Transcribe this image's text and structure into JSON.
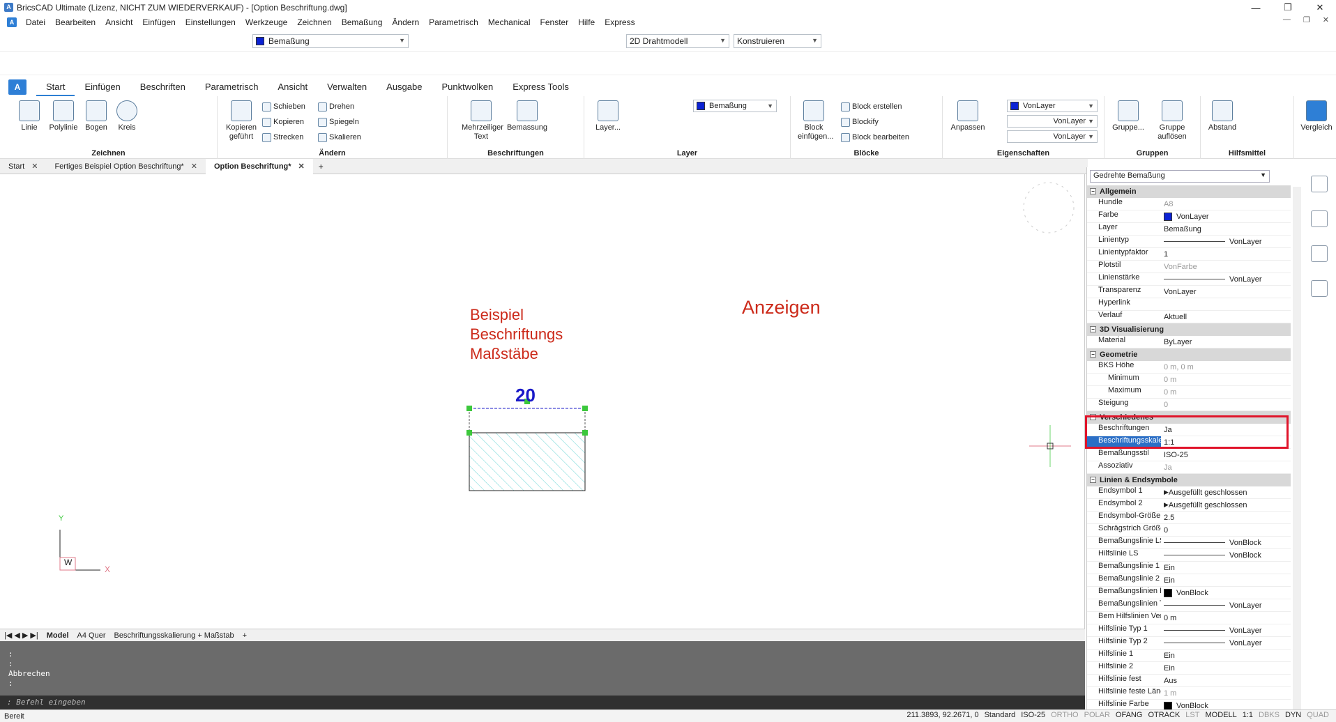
{
  "window": {
    "title": "BricsCAD Ultimate (Lizenz, NICHT ZUM WIEDERVERKAUF) - [Option Beschriftung.dwg]",
    "controls": [
      "—",
      "❐",
      "✕"
    ]
  },
  "menubar": {
    "items": [
      "Datei",
      "Bearbeiten",
      "Ansicht",
      "Einfügen",
      "Einstellungen",
      "Werkzeuge",
      "Zeichnen",
      "Bemaßung",
      "Ändern",
      "Parametrisch",
      "Mechanical",
      "Fenster",
      "Hilfe",
      "Express"
    ]
  },
  "toolbar": {
    "layer_combo": "Bemaßung",
    "workspace_combo": "2D Drahtmodell",
    "mode_combo": "Konstruieren"
  },
  "ribbon": {
    "tabs": [
      "Start",
      "Einfügen",
      "Beschriften",
      "Parametrisch",
      "Ansicht",
      "Verwalten",
      "Ausgabe",
      "Punktwolken",
      "Express Tools"
    ],
    "groups": {
      "zeichnen": "Zeichnen",
      "aendern": "Ändern",
      "beschriftungen": "Beschriftungen",
      "layer": "Layer",
      "bloecke": "Blöcke",
      "eigenschaften": "Eigenschaften",
      "gruppen": "Gruppen",
      "hilfsmittel": "Hilfsmittel"
    },
    "zeichnen": {
      "linie": "Linie",
      "polylinie": "Polylinie",
      "bogen": "Bogen",
      "kreis": "Kreis"
    },
    "aendern": {
      "kopieren_gefuehrt": "Kopieren geführt",
      "schieben": "Schieben",
      "kopieren": "Kopieren",
      "strecken": "Strecken",
      "drehen": "Drehen",
      "spiegeln": "Spiegeln",
      "skalieren": "Skalieren"
    },
    "beschriftungen": {
      "mtext": "Mehrzeiliger Text",
      "bemassung": "Bemassung"
    },
    "layer": {
      "layer_btn": "Layer...",
      "current": "Bemaßung"
    },
    "bloecke": {
      "einfuegen": "Block einfügen...",
      "erstellen": "Block erstellen",
      "blockify": "Blockify",
      "bearbeiten": "Block bearbeiten"
    },
    "eigenschaften": {
      "anpassen": "Anpassen",
      "color": "VonLayer",
      "linetype": "VonLayer",
      "lineweight": "VonLayer"
    },
    "gruppen": {
      "gruppe": "Gruppe...",
      "aufloesen": "Gruppe auflösen"
    },
    "hilfsmittel": {
      "abstand": "Abstand"
    },
    "vergleich": "Vergleich"
  },
  "doctabs": [
    {
      "label": "Start",
      "active": false
    },
    {
      "label": "Fertiges Beispiel Option Beschriftung*",
      "active": false
    },
    {
      "label": "Option Beschriftung*",
      "active": true
    }
  ],
  "drawing": {
    "text_block": [
      "Beispiel",
      "Beschriftungs",
      "Maßstäbe"
    ],
    "anzeigen": "Anzeigen",
    "dimension": "20",
    "ucs": {
      "y": "Y",
      "x": "X",
      "w": "W"
    }
  },
  "layouttabs": [
    "Model",
    "A4 Quer",
    "Beschriftungsskalierung + Maßstab"
  ],
  "command": {
    "lines": [
      ":",
      ":",
      "Abbrechen",
      ":"
    ],
    "input_placeholder": ": Befehl eingeben"
  },
  "status": {
    "left": "Bereit",
    "coords": "211.3893, 92.2671, 0",
    "items": [
      {
        "t": "Standard",
        "on": true
      },
      {
        "t": "ISO-25",
        "on": true
      },
      {
        "t": "ORTHO",
        "on": false
      },
      {
        "t": "POLAR",
        "on": false
      },
      {
        "t": "OFANG",
        "on": true
      },
      {
        "t": "OTRACK",
        "on": true
      },
      {
        "t": "LST",
        "on": false
      },
      {
        "t": "MODELL",
        "on": true
      },
      {
        "t": "1:1",
        "on": true
      },
      {
        "t": "DBKS",
        "on": false
      },
      {
        "t": "DYN",
        "on": true
      },
      {
        "t": "QUAD",
        "on": false
      }
    ]
  },
  "properties": {
    "selector": "Gedrehte Bemaßung",
    "rows": [
      {
        "cat": "Allgemein"
      },
      {
        "k": "Hundle",
        "v": "A8",
        "gray": true
      },
      {
        "k": "Farbe",
        "v": "VonLayer",
        "swatch": "#0b22d4"
      },
      {
        "k": "Layer",
        "v": "Bemaßung"
      },
      {
        "k": "Linientyp",
        "v": "VonLayer",
        "line": true
      },
      {
        "k": "Linientypfaktor",
        "v": "1"
      },
      {
        "k": "Plotstil",
        "v": "VonFarbe",
        "gray": true
      },
      {
        "k": "Linienstärke",
        "v": "VonLayer",
        "line": true
      },
      {
        "k": "Transparenz",
        "v": "VonLayer"
      },
      {
        "k": "Hyperlink",
        "v": ""
      },
      {
        "k": "Verlauf",
        "v": "Aktuell"
      },
      {
        "cat": "3D Visualisierung"
      },
      {
        "k": "Material",
        "v": "ByLayer"
      },
      {
        "cat": "Geometrie"
      },
      {
        "k": "BKS Höhe",
        "v": "0 m, 0 m",
        "gray": true
      },
      {
        "k": "Minimum",
        "v": "0 m",
        "gray": true,
        "indent": true
      },
      {
        "k": "Maximum",
        "v": "0 m",
        "gray": true,
        "indent": true
      },
      {
        "k": "Steigung",
        "v": "0",
        "gray": true
      },
      {
        "cat": "Verschiedenes"
      },
      {
        "k": "Beschriftungen",
        "v": "Ja"
      },
      {
        "k": "Beschriftungsskalen",
        "v": "1:1",
        "sel": true
      },
      {
        "k": "Bemaßungsstil",
        "v": "ISO-25"
      },
      {
        "k": "Assoziativ",
        "v": "Ja",
        "gray": true
      },
      {
        "cat": "Linien & Endsymbole"
      },
      {
        "k": "Endsymbol 1",
        "v": "Ausgefüllt geschlossen",
        "arrow": true
      },
      {
        "k": "Endsymbol 2",
        "v": "Ausgefüllt geschlossen",
        "arrow": true
      },
      {
        "k": "Endsymbol-Größe",
        "v": "2.5"
      },
      {
        "k": "Schrägstrich Größe",
        "v": "0"
      },
      {
        "k": "Bemaßungslinie LS",
        "v": "VonBlock",
        "line": true
      },
      {
        "k": "Hilfslinie LS",
        "v": "VonBlock",
        "line": true
      },
      {
        "k": "Bemaßungslinie 1",
        "v": "Ein"
      },
      {
        "k": "Bemaßungslinie 2",
        "v": "Ein"
      },
      {
        "k": "Bemaßungslinien Farb",
        "v": "VonBlock",
        "swatch": "#000000"
      },
      {
        "k": "Bemaßungslinien Typ",
        "v": "VonLayer",
        "line": true
      },
      {
        "k": "Bem Hilfslinien Verläng",
        "v": "0 m"
      },
      {
        "k": "Hilfslinie Typ 1",
        "v": "VonLayer",
        "line": true
      },
      {
        "k": "Hilfslinie Typ 2",
        "v": "VonLayer",
        "line": true
      },
      {
        "k": "Hilfslinie 1",
        "v": "Ein"
      },
      {
        "k": "Hilfslinie 2",
        "v": "Ein"
      },
      {
        "k": "Hilfslinie fest",
        "v": "Aus"
      },
      {
        "k": "Hilfslinie feste Länge",
        "v": "1 m",
        "gray": true
      },
      {
        "k": "Hilfslinie Farbe",
        "v": "VonBlock",
        "swatch": "#000000"
      }
    ]
  }
}
